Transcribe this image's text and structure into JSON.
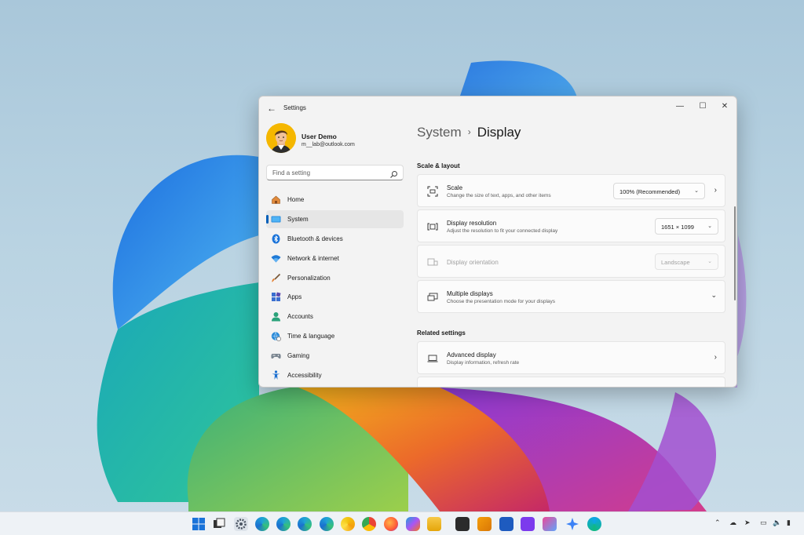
{
  "window": {
    "title": "Settings",
    "back_icon": "arrow-left-icon",
    "controls": {
      "minimize": "—",
      "maximize": "☐",
      "close": "✕"
    }
  },
  "profile": {
    "name": "User Demo",
    "email": "m__lab@outlook.com"
  },
  "search": {
    "placeholder": "Find a setting"
  },
  "sidebar": {
    "items": [
      {
        "label": "Home",
        "icon": "home-icon",
        "selected": false
      },
      {
        "label": "System",
        "icon": "system-icon",
        "selected": true
      },
      {
        "label": "Bluetooth & devices",
        "icon": "bluetooth-icon",
        "selected": false
      },
      {
        "label": "Network & internet",
        "icon": "wifi-icon",
        "selected": false
      },
      {
        "label": "Personalization",
        "icon": "brush-icon",
        "selected": false
      },
      {
        "label": "Apps",
        "icon": "apps-icon",
        "selected": false
      },
      {
        "label": "Accounts",
        "icon": "person-icon",
        "selected": false
      },
      {
        "label": "Time & language",
        "icon": "globe-clock-icon",
        "selected": false
      },
      {
        "label": "Gaming",
        "icon": "gamepad-icon",
        "selected": false
      },
      {
        "label": "Accessibility",
        "icon": "accessibility-icon",
        "selected": false
      }
    ]
  },
  "breadcrumb": {
    "parent": "System",
    "separator": "›",
    "current": "Display"
  },
  "sections": {
    "scale_layout": "Scale & layout",
    "related": "Related settings"
  },
  "cards": {
    "scale": {
      "title": "Scale",
      "subtitle": "Change the size of text, apps, and other items",
      "value": "100% (Recommended)"
    },
    "resolution": {
      "title": "Display resolution",
      "subtitle": "Adjust the resolution to fit your connected display",
      "value": "1651 × 1099"
    },
    "orientation": {
      "title": "Display orientation",
      "subtitle": "",
      "value": "Landscape",
      "disabled": true
    },
    "multiple": {
      "title": "Multiple displays",
      "subtitle": "Choose the presentation mode for your displays"
    },
    "advanced": {
      "title": "Advanced display",
      "subtitle": "Display information, refresh rate"
    }
  },
  "colors": {
    "accent": "#005fb8",
    "window_bg": "#f3f3f3",
    "card_bg": "#fbfbfb"
  },
  "taskbar": {
    "apps": [
      "start-icon",
      "task-view-icon",
      "settings-icon",
      "edge-icon",
      "edge-beta-icon",
      "edge-dev-icon",
      "edge-canary-icon",
      "chrome-canary-icon",
      "chrome-icon",
      "firefox-icon",
      "copilot-icon",
      "file-explorer-icon",
      "terminal-icon",
      "notepad-icon",
      "word-icon",
      "visual-studio-icon",
      "snipping-tool-icon",
      "copilot-star-icon",
      "browser-icon"
    ],
    "tray": [
      "chevron-up-icon",
      "cloud-icon",
      "send-icon",
      "network-icon",
      "volume-icon",
      "battery-icon"
    ]
  }
}
